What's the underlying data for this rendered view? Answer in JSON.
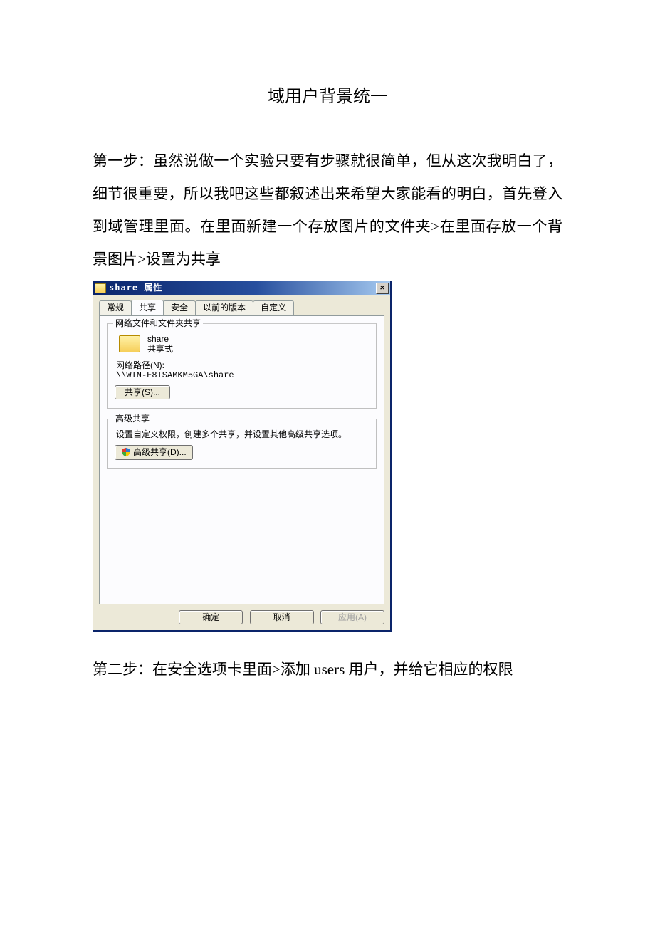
{
  "doc": {
    "title": "域用户背景统一",
    "para1": "第一步：虽然说做一个实验只要有步骤就很简单，但从这次我明白了，细节很重要，所以我吧这些都叙述出来希望大家能看的明白，首先登入到域管理里面。在里面新建一个存放图片的文件夹>在里面存放一个背景图片>设置为共享",
    "para2": "第二步：在安全选项卡里面>添加 users 用户，并给它相应的权限"
  },
  "dialog": {
    "title": "share 属性",
    "close_glyph": "✕",
    "tabs": {
      "general": "常规",
      "share": "共享",
      "security": "安全",
      "prev": "以前的版本",
      "custom": "自定义"
    },
    "group_network": {
      "legend": "网络文件和文件夹共享",
      "folder_name": "share",
      "share_status": "共享式",
      "netpath_label": "网络路径(N):",
      "netpath_value": "\\\\WIN-E8ISAMKM5GA\\share",
      "share_button": "共享(S)..."
    },
    "group_advanced": {
      "legend": "高级共享",
      "desc": "设置自定义权限，创建多个共享，并设置其他高级共享选项。",
      "button": "高级共享(D)..."
    },
    "buttons": {
      "ok": "确定",
      "cancel": "取消",
      "apply": "应用(A)"
    }
  }
}
